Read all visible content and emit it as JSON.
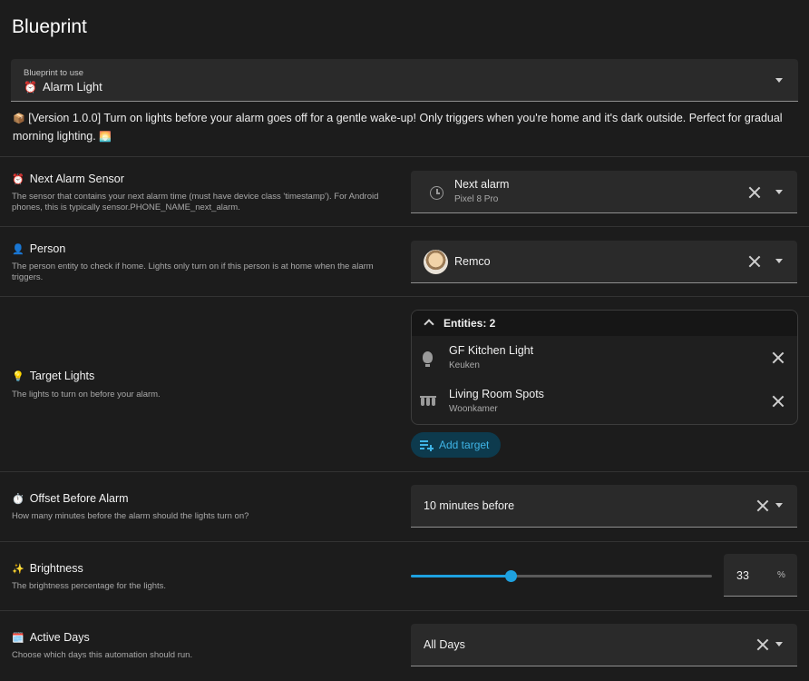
{
  "page": {
    "title": "Blueprint"
  },
  "blueprint": {
    "label": "Blueprint to use",
    "emoji": "⏰",
    "value": "Alarm Light",
    "description_emoji": "📦",
    "description": "[Version 1.0.0] Turn on lights before your alarm goes off for a gentle wake-up! Only triggers when you're home and it's dark outside. Perfect for gradual morning lighting.",
    "description_end_emoji": "🌅"
  },
  "rows": {
    "next_alarm": {
      "emoji": "⏰",
      "title": "Next Alarm Sensor",
      "subtitle": "The sensor that contains your next alarm time (must have device class 'timestamp'). For Android phones, this is typically sensor.PHONE_NAME_next_alarm.",
      "value": "Next alarm",
      "secondary": "Pixel 8 Pro",
      "icon": "alarm-clock-icon"
    },
    "person": {
      "emoji": "👤",
      "title": "Person",
      "subtitle": "The person entity to check if home. Lights only turn on if this person is at home when the alarm triggers.",
      "value": "Remco",
      "icon": "avatar"
    },
    "target_lights": {
      "emoji": "💡",
      "title": "Target Lights",
      "subtitle": "The lights to turn on before your alarm.",
      "entities_label": "Entities: 2",
      "entities": [
        {
          "name": "GF Kitchen Light",
          "area": "Keuken",
          "icon": "lightbulb-icon"
        },
        {
          "name": "Living Room Spots",
          "area": "Woonkamer",
          "icon": "ceiling-spots-icon"
        }
      ],
      "add_label": "Add target"
    },
    "offset": {
      "emoji": "⏱️",
      "title": "Offset Before Alarm",
      "subtitle": "How many minutes before the alarm should the lights turn on?",
      "value": "10 minutes before"
    },
    "brightness": {
      "emoji": "✨",
      "title": "Brightness",
      "subtitle": "The brightness percentage for the lights.",
      "value": "33",
      "unit": "%",
      "slider_fraction": 0.33
    },
    "active_days": {
      "emoji": "🗓️",
      "title": "Active Days",
      "subtitle": "Choose which days this automation should run.",
      "value": "All Days"
    }
  },
  "colors": {
    "background": "#1c1c1c",
    "field": "#2a2a2a",
    "accent": "#1ea1e0",
    "add_target_bg": "#0d3a4d"
  }
}
